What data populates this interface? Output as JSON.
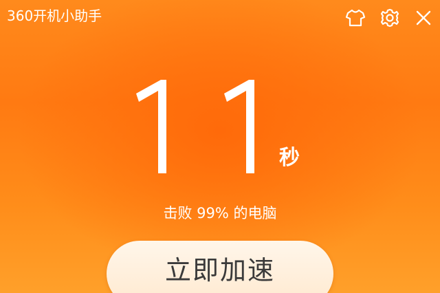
{
  "window": {
    "title": "360开机小助手"
  },
  "toolbar": {
    "skin_icon": "tshirt-icon",
    "settings_icon": "gear-icon",
    "close_icon": "close-icon"
  },
  "boot": {
    "seconds": "11",
    "unit": "秒",
    "beat_text": "击败 99% 的电脑"
  },
  "action": {
    "boost_label": "立即加速"
  },
  "colors": {
    "background": "#ff7a12",
    "button": "#ffeedd",
    "text": "#ffffff"
  }
}
